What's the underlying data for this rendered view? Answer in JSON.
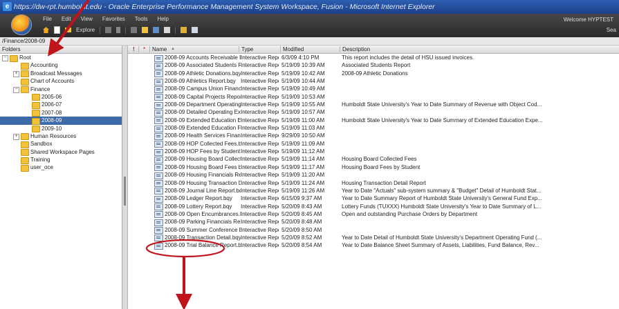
{
  "window": {
    "title": "https://dw-rpt.humboldt.edu - Oracle Enterprise Performance Management System Workspace, Fusion - Microsoft Internet Explorer"
  },
  "menubar": {
    "items": [
      "File",
      "Edit",
      "View",
      "Favorites",
      "Tools",
      "Help"
    ],
    "welcome": "Welcome HYPTEST",
    "explore_label": "Explore",
    "search_label": "Sea"
  },
  "path": "/Finance/2008-09",
  "folders": {
    "header": "Folders",
    "tree": [
      {
        "label": "Root",
        "toggle": "−"
      },
      {
        "label": "Accounting"
      },
      {
        "label": "Broadcast Messages",
        "toggle": "+"
      },
      {
        "label": "Chart of Accounts"
      },
      {
        "label": "Finance",
        "toggle": "−"
      },
      {
        "label": "2005-06"
      },
      {
        "label": "2006-07"
      },
      {
        "label": "2007-08"
      },
      {
        "label": "2008-09",
        "selected": true
      },
      {
        "label": "2009-10"
      },
      {
        "label": "Human Resources",
        "toggle": "+"
      },
      {
        "label": "Sandbox"
      },
      {
        "label": "Shared Workspace Pages"
      },
      {
        "label": "Training"
      },
      {
        "label": "user_oce"
      }
    ]
  },
  "list": {
    "columns": {
      "exclaim": "!",
      "star": "*",
      "name": "Name",
      "sort": "▲",
      "type": "Type",
      "modified": "Modified",
      "description": "Description"
    },
    "rows": [
      {
        "name": "2008-09 Accounts Receivable Bill...",
        "type": "Interactive Repor...",
        "modified": "6/3/09 4:10 PM",
        "description": "This report includes the detail of HSU issued invoices."
      },
      {
        "name": "2008-09 Associated Students Re...",
        "type": "Interactive Repor...",
        "modified": "5/19/09 10:39 AM",
        "description": "Associated Students Report"
      },
      {
        "name": "2008-09 Athletic Donations.bqy",
        "type": "Interactive Repor...",
        "modified": "5/19/09 10:42 AM",
        "description": "2008-09 Athletic Donations"
      },
      {
        "name": "2008-09 Athletics Report.bqy",
        "type": "Interactive Repor...",
        "modified": "5/19/09 10:44 AM",
        "description": ""
      },
      {
        "name": "2008-09 Campus Union Financials...",
        "type": "Interactive Repor...",
        "modified": "5/19/09 10:49 AM",
        "description": ""
      },
      {
        "name": "2008-09 Capital Projects Report.bqy",
        "type": "Interactive Repor...",
        "modified": "5/19/09 10:53 AM",
        "description": ""
      },
      {
        "name": "2008-09 Department Operating Fu...",
        "type": "Interactive Repor...",
        "modified": "5/19/09 10:55 AM",
        "description": "Humboldt State University's Year to Date Summary of Revenue with Object Cod..."
      },
      {
        "name": "2008-09 Detailed Operating Expen...",
        "type": "Interactive Repor...",
        "modified": "5/19/09 10:57 AM",
        "description": ""
      },
      {
        "name": "2008-09 Extended Education Exp...",
        "type": "Interactive Repor...",
        "modified": "5/19/09 11:00 AM",
        "description": "Humboldt State University's Year to Date Summary of Extended Education Expe..."
      },
      {
        "name": "2008-09 Extended Education Fina...",
        "type": "Interactive Repor...",
        "modified": "5/19/09 11:03 AM",
        "description": ""
      },
      {
        "name": "2008-09 Health Services Financial...",
        "type": "Interactive Repor...",
        "modified": "9/29/09 10:50 AM",
        "description": ""
      },
      {
        "name": "2008-09 HOP Collected Fees.bqy",
        "type": "Interactive Repor...",
        "modified": "5/19/09 11:09 AM",
        "description": ""
      },
      {
        "name": "2008-09 HOP Fees by Student.bqy",
        "type": "Interactive Repor...",
        "modified": "5/19/09 11:12 AM",
        "description": ""
      },
      {
        "name": "2008-09 Housing Board Collected ...",
        "type": "Interactive Repor...",
        "modified": "5/19/09 11:14 AM",
        "description": "Housing Board Collected Fees"
      },
      {
        "name": "2008-09 Housing Board Fees by ...",
        "type": "Interactive Repor...",
        "modified": "5/19/09 11:17 AM",
        "description": "Housing Board Fees by Student"
      },
      {
        "name": "2008-09 Housing Financials Repo...",
        "type": "Interactive Repor...",
        "modified": "5/19/09 11:20 AM",
        "description": ""
      },
      {
        "name": "2008-09 Housing Transaction Det...",
        "type": "Interactive Repor...",
        "modified": "5/19/09 11:24 AM",
        "description": "Housing Transaction Detail Report"
      },
      {
        "name": "2008-09 Journal Line Report.bqy",
        "type": "Interactive Repor...",
        "modified": "5/19/09 11:26 AM",
        "description": "Year to Date \"Actuals\" sub-system summary & \"Budget\" Detail of Humboldt Stat..."
      },
      {
        "name": "2008-09 Ledger Report.bqy",
        "type": "Interactive Repor...",
        "modified": "6/15/09 9:37 AM",
        "description": "Year to Date Summary Report of Humboldt State University's General Fund Exp..."
      },
      {
        "name": "2008-09 Lottery Report.bqy",
        "type": "Interactive Repor...",
        "modified": "5/20/09 8:43 AM",
        "description": "Lottery Funds (TUXXX) Humboldt State University's Year to Date Summary of L..."
      },
      {
        "name": "2008-09 Open Encumbrances.bqy",
        "type": "Interactive Repor...",
        "modified": "5/20/09 8:45 AM",
        "description": "Open and outstanding Purchase Orders by Department"
      },
      {
        "name": "2008-09 Parking Financials Report...",
        "type": "Interactive Repor...",
        "modified": "5/20/09 8:48 AM",
        "description": ""
      },
      {
        "name": "2008-09 Summer Conference Exp...",
        "type": "Interactive Repor...",
        "modified": "5/20/09 8:50 AM",
        "description": ""
      },
      {
        "name": "2008-09 Transaction Detail.bqy",
        "type": "Interactive Repor...",
        "modified": "5/20/09 8:52 AM",
        "description": "Year to Date Detail of Humboldt State University's Department Operating Fund (..."
      },
      {
        "name": "2008-09 Trial Balance Report.bqy",
        "type": "Interactive Repor...",
        "modified": "5/20/09 8:54 AM",
        "description": "Year to Date Balance Sheet Summary of Assets, Liabilities, Fund Balance, Rev..."
      }
    ]
  }
}
